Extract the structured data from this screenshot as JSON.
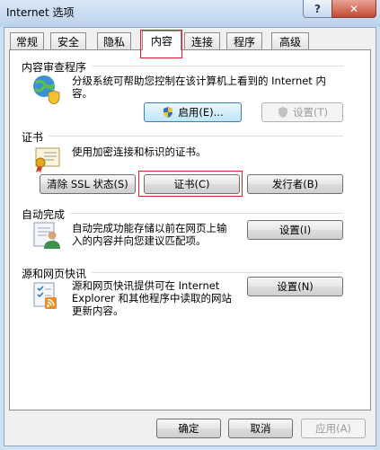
{
  "window": {
    "title": "Internet 选项",
    "help_label": "?",
    "close_label": "✕"
  },
  "tabs": [
    {
      "label": "常规"
    },
    {
      "label": "安全"
    },
    {
      "label": "隐私"
    },
    {
      "label": "内容",
      "active": true
    },
    {
      "label": "连接"
    },
    {
      "label": "程序"
    },
    {
      "label": "高级"
    }
  ],
  "content_advisor": {
    "title": "内容审查程序",
    "description": [
      "分级系统可帮助您控制在该计算机上看到的 Internet 内",
      "容。"
    ],
    "enable_label": "启用(E)...",
    "settings_label": "设置(T)",
    "icon": "globe-shield-icon"
  },
  "certificates": {
    "title": "证书",
    "description": "使用加密连接和标识的证书。",
    "clear_ssl_label": "清除 SSL 状态(S)",
    "certificates_label": "证书(C)",
    "publishers_label": "发行者(B)",
    "icon": "certificate-icon"
  },
  "autocomplete": {
    "title": "自动完成",
    "description": [
      "自动完成功能存储以前在网页上输",
      "入的内容并向您建议匹配项。"
    ],
    "settings_label": "设置(I)",
    "icon": "user-form-icon"
  },
  "feeds": {
    "title": "源和网页快讯",
    "description": [
      "源和网页快讯提供可在 Internet",
      "Explorer 和其他程序中读取的网站",
      "更新内容。"
    ],
    "settings_label": "设置(N)",
    "icon": "rss-feed-icon"
  },
  "footer": {
    "ok_label": "确定",
    "cancel_label": "取消",
    "apply_label": "应用(A)"
  },
  "colors": {
    "highlight_box": "#d9222a",
    "titlebar": "#c7dbf0",
    "panel": "#ffffff"
  }
}
